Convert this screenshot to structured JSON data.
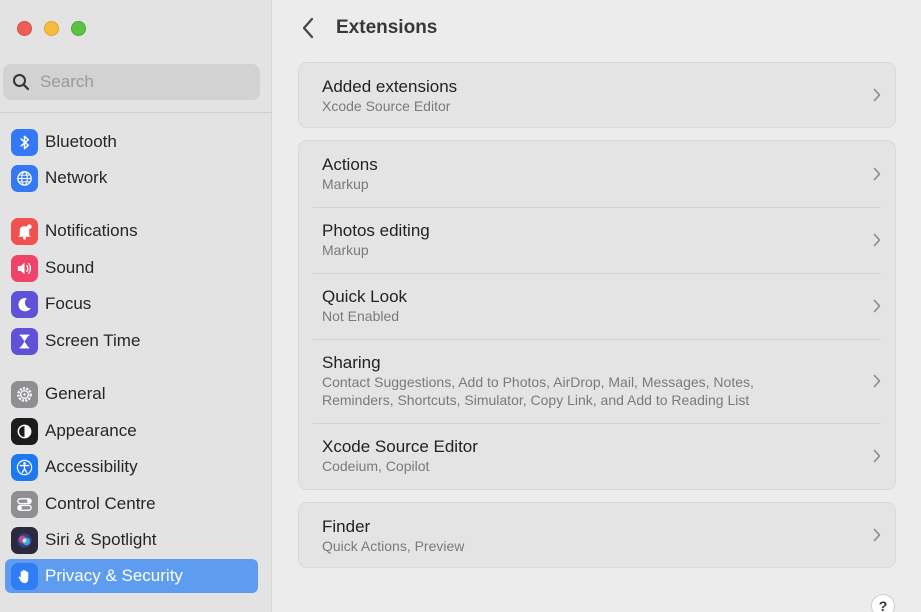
{
  "sidebar": {
    "search_placeholder": "Search",
    "items": [
      {
        "label": "Bluetooth",
        "icon": "bluetooth-icon",
        "color": "#3478f6"
      },
      {
        "label": "Network",
        "icon": "globe-icon",
        "color": "#3478f6"
      },
      {
        "label": "Notifications",
        "icon": "bell-icon",
        "color": "#f0524f"
      },
      {
        "label": "Sound",
        "icon": "speaker-icon",
        "color": "#f0436a"
      },
      {
        "label": "Focus",
        "icon": "moon-icon",
        "color": "#5d52d8"
      },
      {
        "label": "Screen Time",
        "icon": "hourglass-icon",
        "color": "#5d52d8"
      },
      {
        "label": "General",
        "icon": "gear-icon",
        "color": "#8e8e93"
      },
      {
        "label": "Appearance",
        "icon": "appearance-icon",
        "color": "#1c1c1e"
      },
      {
        "label": "Accessibility",
        "icon": "accessibility-icon",
        "color": "#1e78f0"
      },
      {
        "label": "Control Centre",
        "icon": "toggles-icon",
        "color": "#8e8e93"
      },
      {
        "label": "Siri & Spotlight",
        "icon": "siri-icon",
        "color": "#2a2a3a"
      },
      {
        "label": "Privacy & Security",
        "icon": "hand-icon",
        "color": "#2f7cf6",
        "selected": true
      }
    ]
  },
  "header": {
    "title": "Extensions"
  },
  "groups": [
    {
      "rows": [
        {
          "title": "Added extensions",
          "subtitle": "Xcode Source Editor"
        }
      ]
    },
    {
      "rows": [
        {
          "title": "Actions",
          "subtitle": "Markup"
        },
        {
          "title": "Photos editing",
          "subtitle": "Markup"
        },
        {
          "title": "Quick Look",
          "subtitle": "Not Enabled"
        },
        {
          "title": "Sharing",
          "subtitle": "Contact Suggestions, Add to Photos, AirDrop, Mail, Messages, Notes,",
          "subtitle2": "Reminders, Shortcuts, Simulator, Copy Link, and Add to Reading List"
        },
        {
          "title": "Xcode Source Editor",
          "subtitle": "Codeium, Copilot"
        }
      ]
    },
    {
      "rows": [
        {
          "title": "Finder",
          "subtitle": "Quick Actions, Preview"
        }
      ]
    }
  ],
  "help_label": "?"
}
